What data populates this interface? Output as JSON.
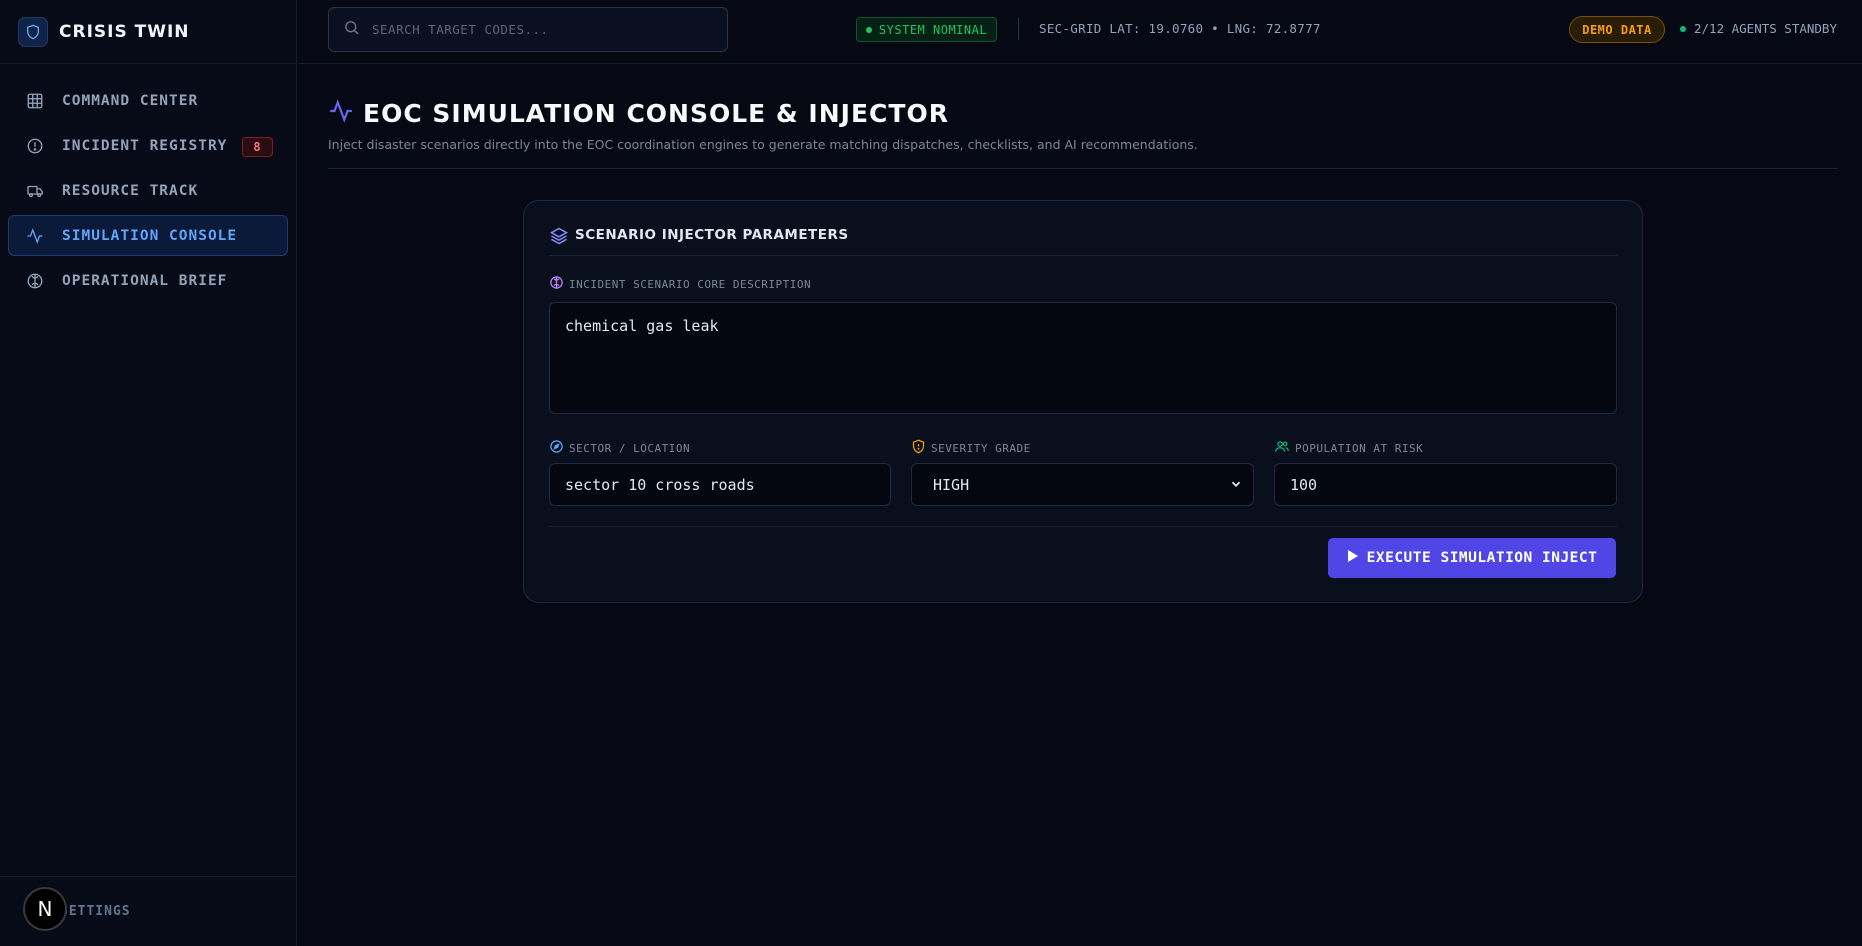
{
  "brand": {
    "name": "CRISIS TWIN"
  },
  "sidebar": {
    "items": [
      {
        "label": "COMMAND CENTER",
        "icon": "grid-icon"
      },
      {
        "label": "INCIDENT REGISTRY",
        "icon": "alert-circle-icon",
        "badge": "8"
      },
      {
        "label": "RESOURCE TRACK",
        "icon": "truck-icon"
      },
      {
        "label": "SIMULATION CONSOLE",
        "icon": "activity-icon",
        "active": true
      },
      {
        "label": "OPERATIONAL BRIEF",
        "icon": "brain-icon"
      }
    ],
    "settings_label": "SETTINGS",
    "next_badge": "N"
  },
  "topbar": {
    "search_placeholder": "SEARCH TARGET CODES...",
    "system_status": "SYSTEM NOMINAL",
    "coordinates": "SEC-GRID LAT: 19.0760 • LNG: 72.8777",
    "demo_badge": "DEMO DATA",
    "agents_status": "2/12 AGENTS STANDBY"
  },
  "main": {
    "title": "EOC SIMULATION CONSOLE & INJECTOR",
    "subtitle": "Inject disaster scenarios directly into the EOC coordination engines to generate matching dispatches, checklists, and AI recommendations."
  },
  "form": {
    "card_title": "SCENARIO INJECTOR PARAMETERS",
    "description_label": "INCIDENT SCENARIO CORE DESCRIPTION",
    "description_value": "chemical gas leak",
    "sector_label": "SECTOR / LOCATION",
    "sector_value": "sector 10 cross roads",
    "severity_label": "SEVERITY GRADE",
    "severity_value": "HIGH",
    "population_label": "POPULATION AT RISK",
    "population_value": "100",
    "execute_label": "EXECUTE SIMULATION INJECT"
  },
  "colors": {
    "accent": "#4f46e5",
    "active_nav": "#60a5fa",
    "status_green": "#22c55e",
    "demo_amber": "#f59e0b",
    "danger_red": "#f87171"
  }
}
